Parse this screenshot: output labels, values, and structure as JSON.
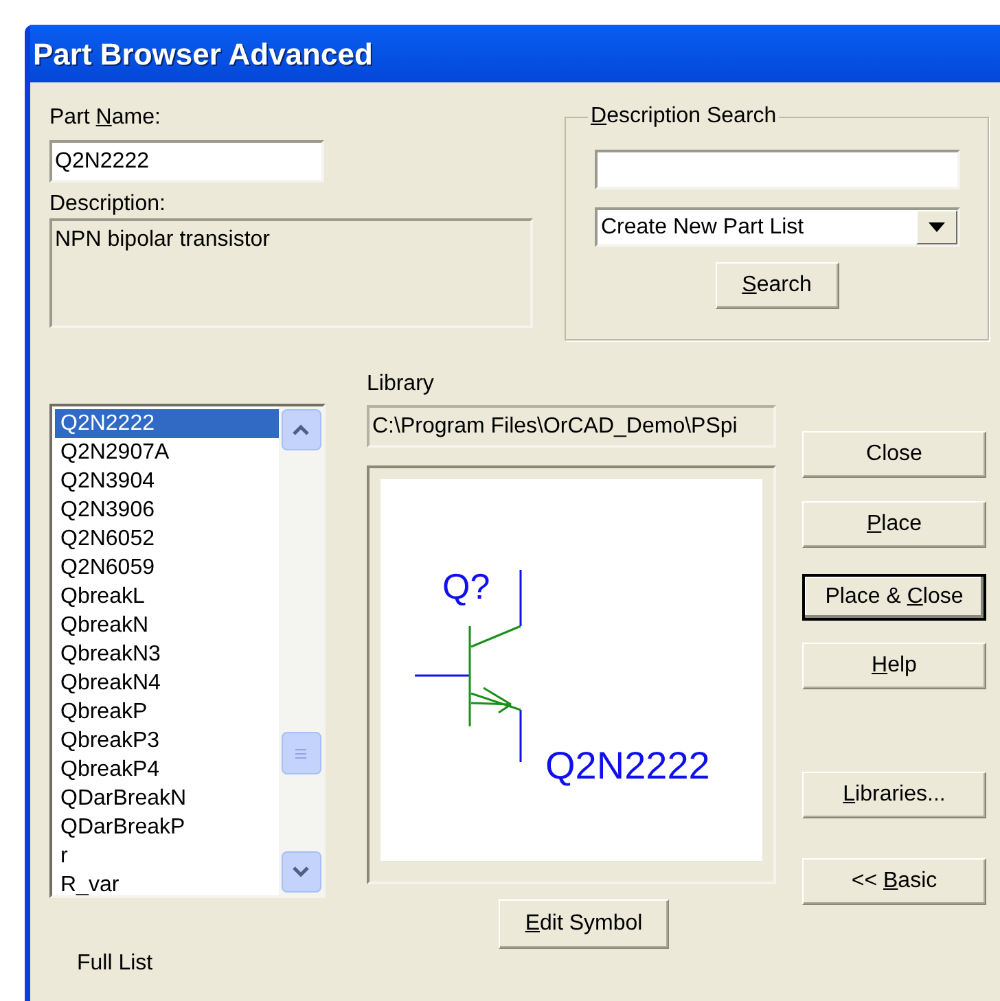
{
  "window": {
    "title": "Part Browser Advanced"
  },
  "part_name": {
    "label": {
      "pre": "Part ",
      "key": "N",
      "post": "ame:"
    },
    "value": "Q2N2222"
  },
  "description": {
    "label": "Description:",
    "value": "NPN bipolar transistor"
  },
  "description_search": {
    "title": {
      "key": "D",
      "post": "escription Search"
    },
    "dropdown": "Create New Part List",
    "button": {
      "key": "S",
      "post": "earch"
    }
  },
  "parts": [
    {
      "name": "Q2N2222",
      "selected": true
    },
    {
      "name": "Q2N2907A",
      "selected": false
    },
    {
      "name": "Q2N3904",
      "selected": false
    },
    {
      "name": "Q2N3906",
      "selected": false
    },
    {
      "name": "Q2N6052",
      "selected": false
    },
    {
      "name": "Q2N6059",
      "selected": false
    },
    {
      "name": "QbreakL",
      "selected": false
    },
    {
      "name": "QbreakN",
      "selected": false
    },
    {
      "name": "QbreakN3",
      "selected": false
    },
    {
      "name": "QbreakN4",
      "selected": false
    },
    {
      "name": "QbreakP",
      "selected": false
    },
    {
      "name": "QbreakP3",
      "selected": false
    },
    {
      "name": "QbreakP4",
      "selected": false
    },
    {
      "name": "QDarBreakN",
      "selected": false
    },
    {
      "name": "QDarBreakP",
      "selected": false
    },
    {
      "name": "r",
      "selected": false
    },
    {
      "name": "R_var",
      "selected": false
    }
  ],
  "full_list_label": "Full List",
  "library": {
    "label": "Library",
    "path": "C:\\Program Files\\OrCAD_Demo\\PSpi"
  },
  "preview": {
    "reference": "Q?",
    "value": "Q2N2222"
  },
  "edit_symbol_button": {
    "key": "E",
    "post": "dit Symbol"
  },
  "buttons": [
    {
      "label": {
        "pre": "Close"
      },
      "default": false
    },
    {
      "label": {
        "key": "P",
        "post": "lace"
      },
      "default": false
    },
    {
      "label": {
        "pre": "Place & ",
        "key": "C",
        "post": "lose"
      },
      "default": true
    },
    {
      "label": {
        "key": "H",
        "post": "elp"
      },
      "default": false
    },
    {
      "label": {
        "key": "L",
        "post": "ibraries..."
      },
      "default": false
    },
    {
      "label": {
        "pre": "<< ",
        "key": "B",
        "post": "asic"
      },
      "default": false
    }
  ]
}
